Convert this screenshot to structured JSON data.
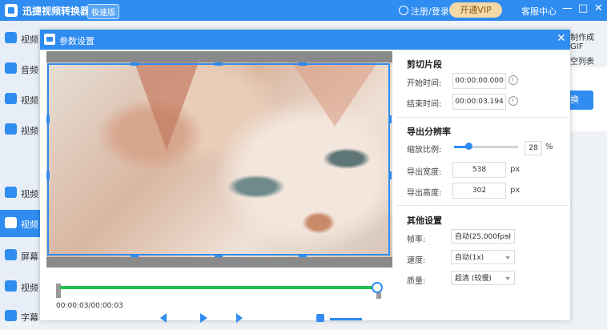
{
  "app": {
    "title": "迅捷视频转换器",
    "badge": "极速版",
    "login": "注册/登录",
    "vip": "开通VIP",
    "help": "客服中心",
    "min": "—",
    "max": "□",
    "close": "✕"
  },
  "sidebar": {
    "items": [
      {
        "label": "视频"
      },
      {
        "label": "音频"
      },
      {
        "label": "视频"
      },
      {
        "label": "视频"
      },
      {
        "label": "视频"
      },
      {
        "label": "视频"
      },
      {
        "label": "屏幕"
      },
      {
        "label": "视频"
      },
      {
        "label": "字幕"
      }
    ]
  },
  "main_peek": {
    "gif": "制作成GIF",
    "clear": "空列表",
    "convert": "换"
  },
  "dialog": {
    "title": "参数设置",
    "close": "✕",
    "timecode": "00:00:03/00:00:03",
    "cut": {
      "title": "剪切片段",
      "start_label": "开始时间:",
      "start_value": "00:00:00.000",
      "end_label": "结束时间:",
      "end_value": "00:00:03.194"
    },
    "resolution": {
      "title": "导出分辨率",
      "scale_label": "缩放比例:",
      "scale_value": "28",
      "scale_unit": "%",
      "width_label": "导出宽度:",
      "width_value": "538",
      "height_label": "导出高度:",
      "height_value": "302",
      "px": "px"
    },
    "other": {
      "title": "其他设置",
      "fps_label": "帧率:",
      "fps_value": "自动(25.000fps)",
      "speed_label": "速度:",
      "speed_value": "自动(1x)",
      "quality_label": "质量:",
      "quality_value": "超清 (较慢)"
    },
    "timeline_progress": 1.0,
    "scale_progress": 0.28
  }
}
